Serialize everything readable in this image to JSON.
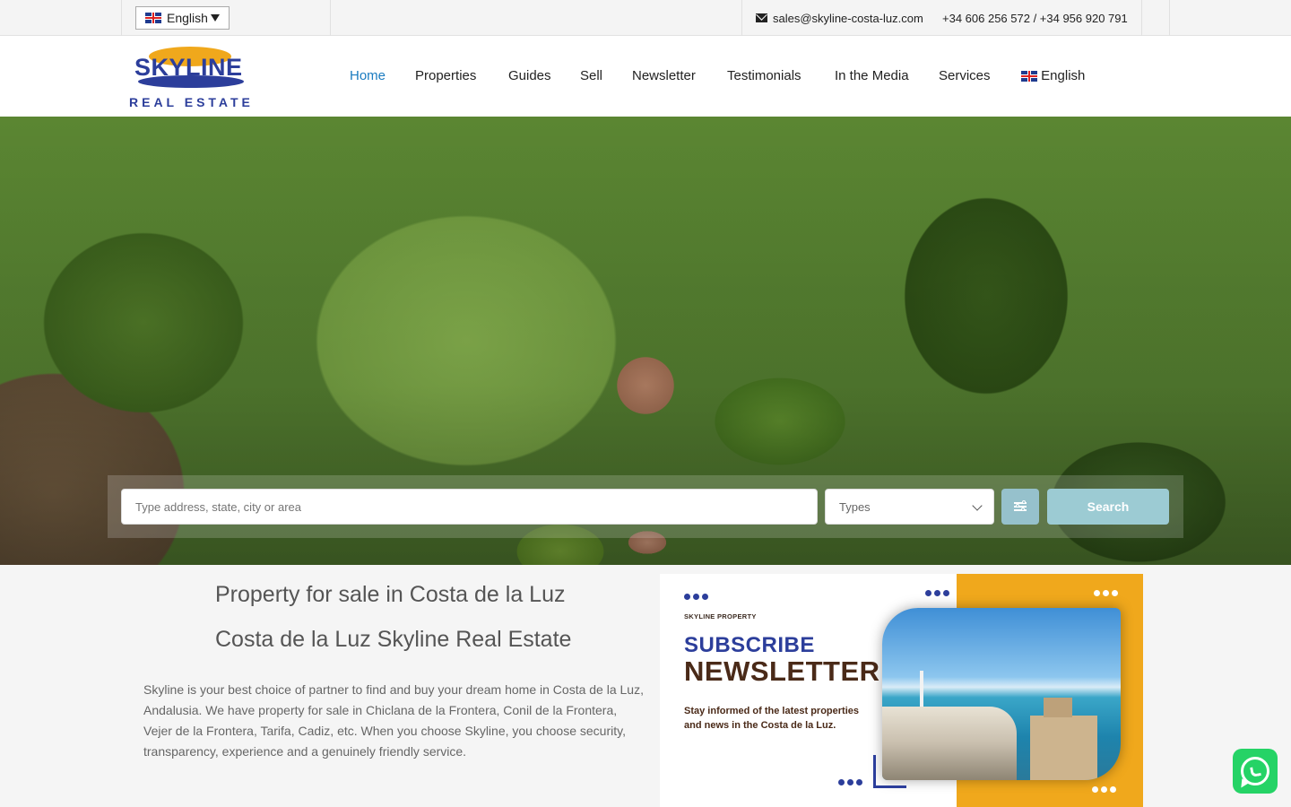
{
  "topbar": {
    "language": "English",
    "email": "sales@skyline-costa-luz.com",
    "phones": "+34 606 256 572 / +34 956 920 791"
  },
  "header": {
    "logo": {
      "line1": "SKYLINE",
      "line2": "REAL ESTATE"
    },
    "nav": [
      {
        "label": "Home",
        "active": true
      },
      {
        "label": "Properties"
      },
      {
        "label": "Guides"
      },
      {
        "label": "Sell"
      },
      {
        "label": "Newsletter"
      },
      {
        "label": "Testimonials"
      },
      {
        "label": "In the Media"
      },
      {
        "label": "Services"
      },
      {
        "label": "English"
      }
    ],
    "accent_color": "#1a7bc0"
  },
  "search": {
    "placeholder": "Type address, state, city or area",
    "types_label": "Types",
    "button_label": "Search",
    "button_color": "#9ccbd3"
  },
  "content": {
    "title1": "Property for sale in Costa de la Luz",
    "title2": "Costa de la Luz Skyline Real Estate",
    "intro": "Skyline is your best choice of partner to find and buy your dream home in Costa de la Luz, Andalusia. We have property for sale in Chiclana de la Frontera, Conil de la Frontera, Vejer de la Frontera, Tarifa, Cadiz, etc. When you choose Skyline, you choose security, transparency, experience and a genuinely friendly service."
  },
  "newsletter_banner": {
    "brand": "SKYLINE PROPERTY",
    "subscribe": "SUBSCRIBE",
    "newsletter": "NEWSLETTER",
    "text": "Stay informed of the latest properties and news in the Costa de la Luz.",
    "brand_color": "#2c3e9b",
    "accent_color": "#f0a81c"
  },
  "icons": {
    "mail": "envelope-icon",
    "whatsapp": "whatsapp-icon",
    "filters": "sliders-icon"
  }
}
